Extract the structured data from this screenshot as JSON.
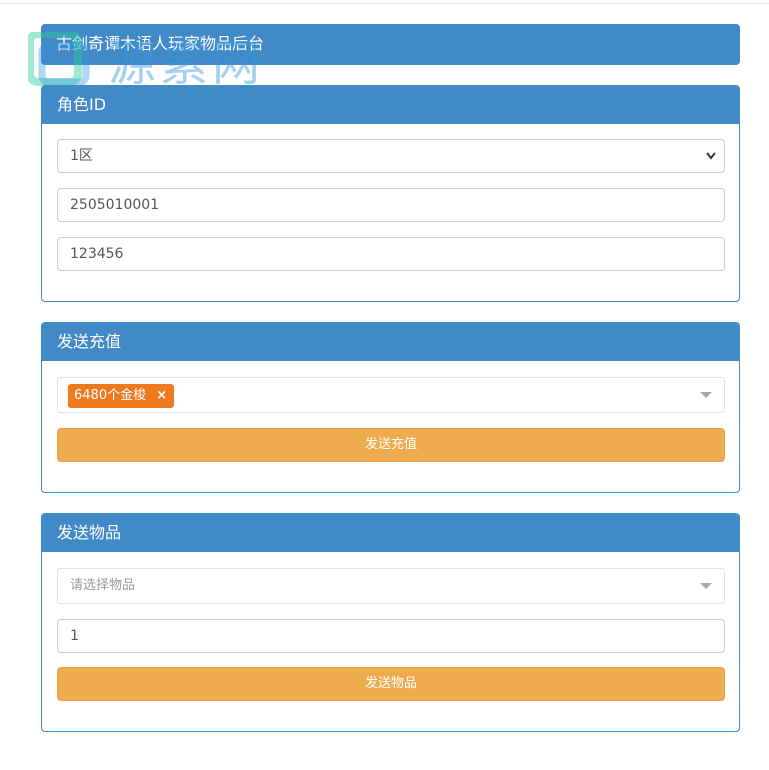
{
  "header": {
    "title": "古剑奇谭木语人玩家物品后台"
  },
  "watermark": {
    "text": "源素网"
  },
  "role_panel": {
    "heading": "角色ID",
    "server_select": {
      "value": "1区"
    },
    "account_field": {
      "value": "2505010001"
    },
    "password_field": {
      "value": "123456"
    }
  },
  "recharge_panel": {
    "heading": "发送充值",
    "selected_tag": {
      "label": "6480个金梭",
      "remove": "×"
    },
    "submit_label": "发送充值"
  },
  "item_panel": {
    "heading": "发送物品",
    "item_select": {
      "placeholder": "请选择物品"
    },
    "quantity_field": {
      "value": "1"
    },
    "submit_label": "发送物品"
  },
  "colors": {
    "panel_header": "#4189c7",
    "button": "#efac4e",
    "tag": "#ee7a20"
  }
}
